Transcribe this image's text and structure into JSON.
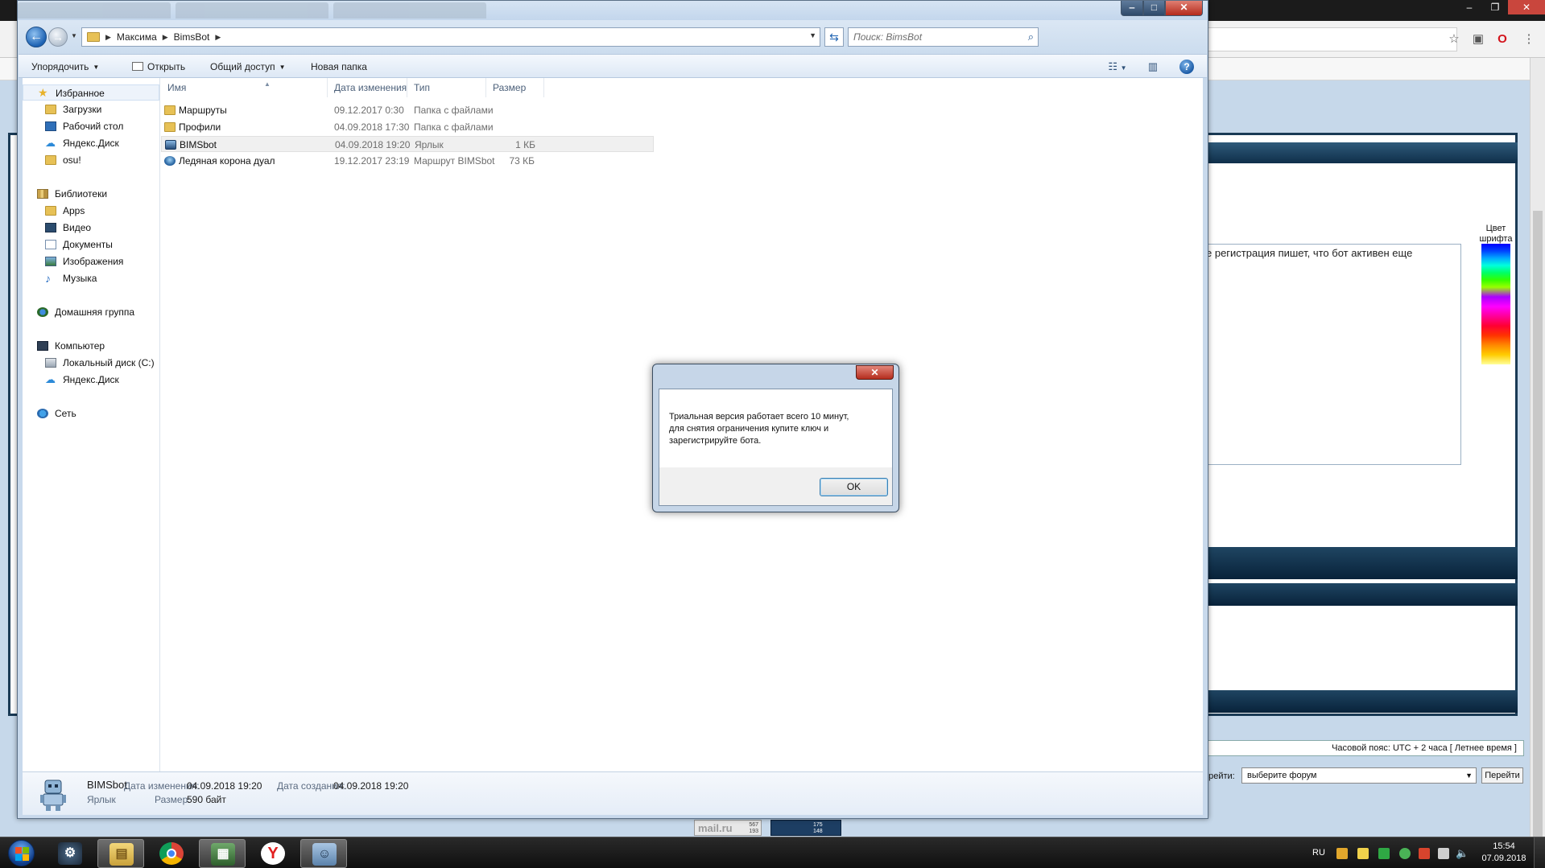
{
  "explorer": {
    "breadcrumb": [
      "Максима",
      "BimsBot"
    ],
    "search_placeholder": "Поиск: BimsBot",
    "commands": {
      "organize": "Упорядочить",
      "open": "Открыть",
      "share": "Общий доступ",
      "new_folder": "Новая папка"
    },
    "nav": {
      "favorites": "Избранное",
      "downloads": "Загрузки",
      "desktop": "Рабочий стол",
      "yandex_disk": "Яндекс.Диск",
      "osu": "osu!",
      "libraries": "Библиотеки",
      "apps": "Apps",
      "video": "Видео",
      "documents": "Документы",
      "images": "Изображения",
      "music": "Музыка",
      "homegroup": "Домашняя группа",
      "computer": "Компьютер",
      "local_disk": "Локальный диск (C:)",
      "yandex_disk_2": "Яндекс.Диск",
      "network": "Сеть"
    },
    "columns": {
      "name": "Имя",
      "date": "Дата изменения",
      "type": "Тип",
      "size": "Размер"
    },
    "files": [
      {
        "name": "Маршруты",
        "date": "09.12.2017 0:30",
        "type": "Папка с файлами",
        "size": "",
        "icon": "folder-icon"
      },
      {
        "name": "Профили",
        "date": "04.09.2018 17:30",
        "type": "Папка с файлами",
        "size": "",
        "icon": "folder-icon"
      },
      {
        "name": "BIMSbot",
        "date": "04.09.2018 19:20",
        "type": "Ярлык",
        "size": "1 КБ",
        "icon": "shortcut-icon"
      },
      {
        "name": "Ледяная корона дуал",
        "date": "19.12.2017 23:19",
        "type": "Маршрут BIMSbot",
        "size": "73 КБ",
        "icon": "route-file-icon"
      }
    ],
    "details": {
      "name": "BIMSbot",
      "kind": "Ярлык",
      "modified_label": "Дата изменения:",
      "modified_value": "04.09.2018 19:20",
      "created_label": "Дата создания:",
      "created_value": "04.09.2018 19:20",
      "size_label": "Размер:",
      "size_value": "590 байт"
    }
  },
  "dialog": {
    "close_glyph": "✕",
    "message_lines": [
      "Триальная версия работает всего 10 минут,",
      "для снятия ограничения купите ключ и",
      "зарегистрируйте бота."
    ],
    "ok_label": "OK"
  },
  "browser": {
    "post_text": "е регистрация пишет, что бот активен еще",
    "font_color_label": [
      "Цвет",
      "шрифта"
    ],
    "timezone": "Часовой пояс: UTC + 2 часа [ Летнее время ]",
    "jump_label": "ерейти:",
    "jump_select": "выберите форум",
    "jump_button": "Перейти",
    "counter1": {
      "logo": "mail.ru",
      "a": "567",
      "b": "193"
    },
    "counter2": {
      "a": "175",
      "b": "148"
    }
  },
  "taskbar": {
    "language": "RU",
    "time": "15:54",
    "date": "07.09.2018"
  },
  "colors": {
    "accent": "#1d62b3",
    "dialog_close": "#b52d1d",
    "forum_band": "#0f2f4a"
  }
}
